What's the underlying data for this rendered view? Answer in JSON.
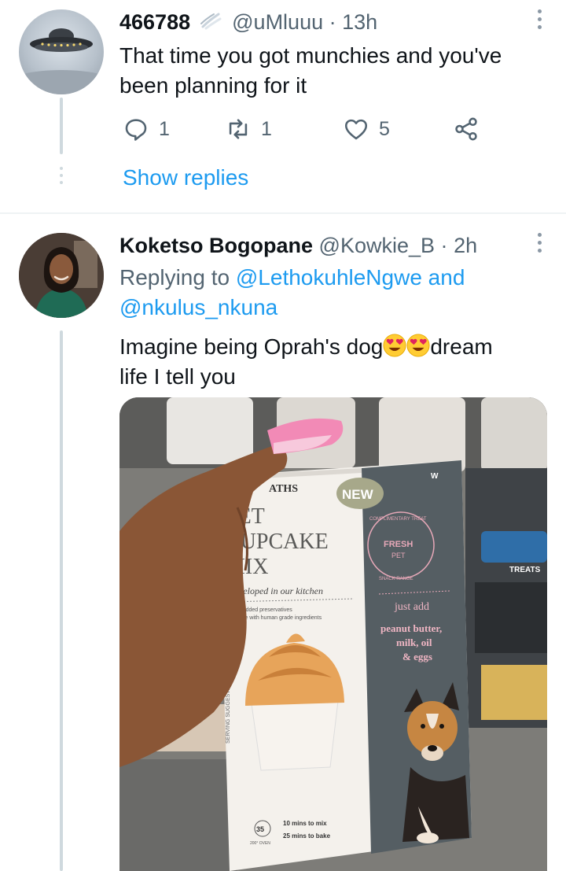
{
  "tweet1": {
    "name": "466788",
    "handle": "@uMluuu",
    "separator": "·",
    "time": "13h",
    "text_line1": "That time you got munchies and you've",
    "text_line2": "been planning for it",
    "reply_count": "1",
    "retweet_count": "1",
    "like_count": "5",
    "show_replies": "Show replies"
  },
  "tweet2": {
    "name": "Koketso Bogopane",
    "handle": "@Kowkie_B",
    "separator": "·",
    "time": "2h",
    "replying_prefix": "Replying to",
    "reply_mention1": "@LethokuhleNgwe",
    "reply_and": "and",
    "reply_mention2": "@nkulus_nkuna",
    "text_part1": "Imagine being Oprah's dog",
    "text_part2": "dream",
    "text_line2": "life I tell you",
    "emoji": "heart-eyes-emoji",
    "image": {
      "brand_partial": "ATHS",
      "badge": "NEW",
      "corner_letter": "W",
      "title_line1": "PET",
      "title_line2": "CUPCAKE",
      "title_line3": "MIX",
      "tagline": "Developed in our kitchen",
      "bullet1": "✓ No added preservatives",
      "bullet2": "✓ Made with human grade ingredients",
      "seal_top": "COMPLIMENTARY TREAT",
      "seal_mid1": "FRESH",
      "seal_mid2": "PET",
      "seal_bottom": "SNACK RANGE",
      "just_add": "just add",
      "ingredients1": "peanut butter,",
      "ingredients2": "milk, oil",
      "ingredients3": "& eggs",
      "side_text": "SERVING SUGGESTION",
      "time_badge": "35",
      "oven": "200° OVEN",
      "mix_time": "10 mins to mix",
      "bake_time": "25 mins to bake",
      "shelf_label": "TREATS"
    }
  },
  "colors": {
    "link": "#1d9bf0",
    "secondary_text": "#536471",
    "divider": "#eff3f4",
    "thread_line": "#cfd9de"
  }
}
